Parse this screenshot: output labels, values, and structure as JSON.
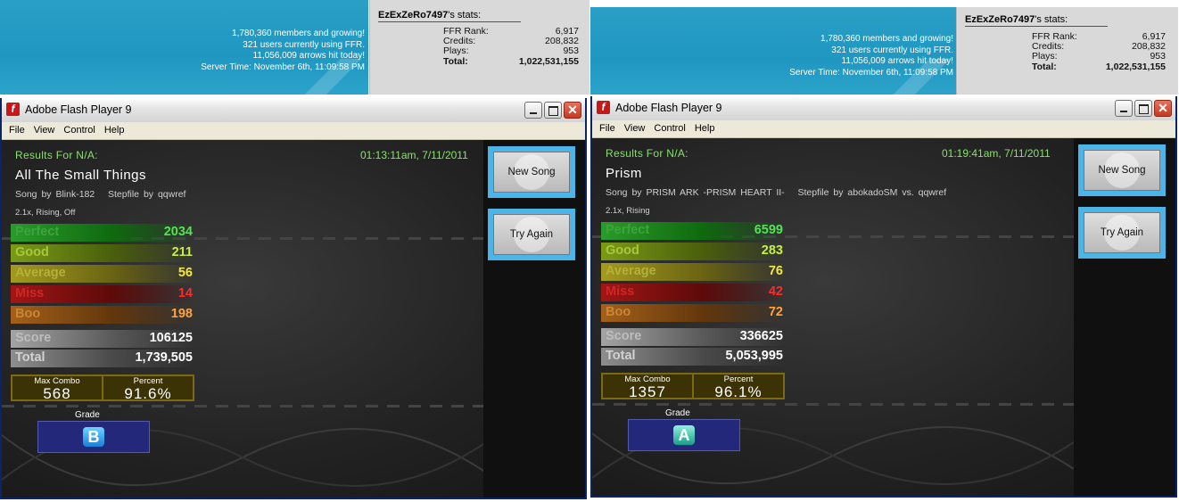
{
  "site": {
    "members": "1,780,360 members and growing!",
    "users_online": "321 users currently using FFR.",
    "arrows_today": "11,056,009 arrows hit today!",
    "server_time": "Server Time: November 6th, 11:09:58 PM"
  },
  "user": {
    "name": "EzExZeRo7497",
    "stats_suffix": "'s stats:",
    "rank_label": "FFR Rank:",
    "rank_value": "6,917",
    "credits_label": "Credits:",
    "credits_value": "208,832",
    "plays_label": "Plays:",
    "plays_value": "953",
    "total_label": "Total:",
    "total_value": "1,022,531,155"
  },
  "window": {
    "title": "Adobe Flash Player 9",
    "icon": "flash-player-icon",
    "menu": [
      "File",
      "View",
      "Control",
      "Help"
    ]
  },
  "colors": {
    "accent_green": "#8ae06e",
    "button_blue": "#4db4e8",
    "grade_bg": "#23287a"
  },
  "results": [
    {
      "results_for": "Results For N/A:",
      "datetime": "01:13:11am, 7/11/2011",
      "song_title": "All The Small Things",
      "song_by": "Song by Blink-182",
      "stepfile_by": "Stepfile by qqwref",
      "mods": "2.1x, Rising, Off",
      "judgements": {
        "perfect_label": "Perfect",
        "perfect": "2034",
        "good_label": "Good",
        "good": "211",
        "average_label": "Average",
        "average": "56",
        "miss_label": "Miss",
        "miss": "14",
        "boo_label": "Boo",
        "boo": "198"
      },
      "score_label": "Score",
      "score": "106125",
      "total_label": "Total",
      "total": "1,739,505",
      "max_combo_label": "Max Combo",
      "max_combo": "568",
      "percent_label": "Percent",
      "percent": "91.6%",
      "grade_label": "Grade",
      "grade": "B",
      "new_song_label": "New Song",
      "try_again_label": "Try Again"
    },
    {
      "results_for": "Results For N/A:",
      "datetime": "01:19:41am, 7/11/2011",
      "song_title": "Prism",
      "song_by": "Song by PRISM ARK -PRISM HEART II-",
      "stepfile_by": "Stepfile by abokadoSM vs. qqwref",
      "mods": "2.1x, Rising",
      "judgements": {
        "perfect_label": "Perfect",
        "perfect": "6599",
        "good_label": "Good",
        "good": "283",
        "average_label": "Average",
        "average": "76",
        "miss_label": "Miss",
        "miss": "42",
        "boo_label": "Boo",
        "boo": "72"
      },
      "score_label": "Score",
      "score": "336625",
      "total_label": "Total",
      "total": "5,053,995",
      "max_combo_label": "Max Combo",
      "max_combo": "1357",
      "percent_label": "Percent",
      "percent": "96.1%",
      "grade_label": "Grade",
      "grade": "A",
      "new_song_label": "New Song",
      "try_again_label": "Try Again"
    }
  ]
}
